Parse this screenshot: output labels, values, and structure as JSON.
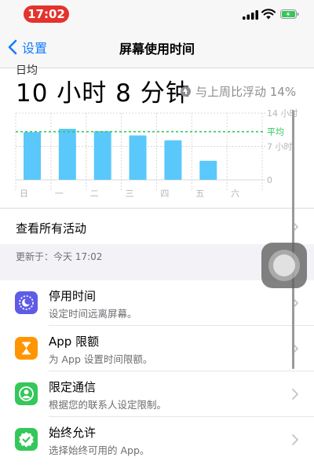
{
  "status_bar": {
    "time": "17:02",
    "time_pill_color": "#e5322d"
  },
  "nav": {
    "back_label": "设置",
    "title": "屏幕使用时间"
  },
  "summary": {
    "cut_label": "日均",
    "total": "10 小时 8 分钟",
    "compare_text": "与上周比浮动 14%"
  },
  "chart_data": {
    "type": "bar",
    "categories": [
      "日",
      "一",
      "二",
      "三",
      "四",
      "五",
      "六"
    ],
    "series": [
      {
        "values": [
          10.0,
          10.7,
          10.2,
          9.3,
          8.3,
          4.0,
          null
        ]
      }
    ],
    "y_ticks": [
      {
        "label": "14 小时",
        "value": 14
      },
      {
        "label": "7 小时",
        "value": 7
      },
      {
        "label": "0",
        "value": 0
      }
    ],
    "average_label": "平均",
    "average_value": 10.1,
    "ylim": [
      0,
      14
    ],
    "bar_color": "#5ac8fa",
    "average_color": "#34c759",
    "grid": true
  },
  "activity_row": {
    "label": "查看所有活动"
  },
  "updated": {
    "text": "更新于：今天 17:02"
  },
  "items": [
    {
      "title": "停用时间",
      "subtitle": "设定时间远离屏幕。",
      "icon": "downtime-icon",
      "color": "#5e5ce6"
    },
    {
      "title": "App 限额",
      "subtitle": "为 App 设置时间限额。",
      "icon": "hourglass-icon",
      "color": "#ff9500"
    },
    {
      "title": "限定通信",
      "subtitle": "根据您的联系人设定限制。",
      "icon": "contact-icon",
      "color": "#34c759"
    },
    {
      "title": "始终允许",
      "subtitle": "选择始终可用的 App。",
      "icon": "checkmark-badge-icon",
      "color": "#34c759"
    }
  ]
}
